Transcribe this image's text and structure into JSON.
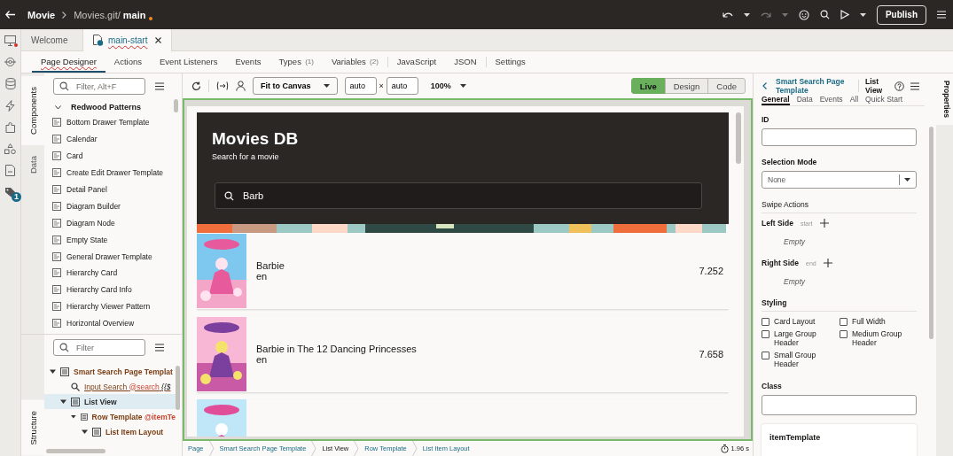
{
  "top_bar": {
    "app": "Movie",
    "path": "Movies.git/",
    "branch": "main",
    "unsaved": true,
    "redo_disabled": true,
    "publish": "Publish"
  },
  "rail": {
    "alert": true,
    "badge": "1"
  },
  "editor_tabs": [
    {
      "label": "Welcome",
      "selected": false
    },
    {
      "label": "main-start",
      "selected": true
    }
  ],
  "designer_tabs": [
    {
      "label": "Page Designer",
      "selected": true
    },
    {
      "label": "Actions",
      "selected": false
    },
    {
      "label": "Event Listeners",
      "selected": false
    },
    {
      "label": "Events",
      "selected": false
    },
    {
      "label": "Types",
      "count": "(1)",
      "selected": false
    },
    {
      "label": "Variables",
      "count": "(2)",
      "selected": false
    },
    {
      "label": "JavaScript",
      "selected": false,
      "separator_before": true
    },
    {
      "label": "JSON",
      "selected": false
    },
    {
      "label": "Settings",
      "selected": false,
      "separator_before": true
    }
  ],
  "side_tabs": [
    {
      "label": "Components",
      "selected": true
    },
    {
      "label": "Data",
      "selected": false
    }
  ],
  "components": {
    "placeholder": "Filter, Alt+F",
    "group": "Redwood Patterns",
    "expanded": true,
    "items": [
      "Bottom Drawer Template",
      "Calendar",
      "Card",
      "Create Edit Drawer Template",
      "Detail Panel",
      "Diagram Builder",
      "Diagram Node",
      "Empty State",
      "General Drawer Template",
      "Hierarchy Card",
      "Hierarchy Card Info",
      "Hierarchy Viewer Pattern",
      "Horizontal Overview"
    ]
  },
  "structure": {
    "tab": "Structure",
    "placeholder": "Filter",
    "tree": [
      {
        "label": "Smart Search Page Templat",
        "expanded": true,
        "selected": false,
        "children": [
          {
            "kind": "search",
            "label": "Input Search",
            "binding": "@search",
            "extra": "{{$",
            "selected": false
          },
          {
            "label": "List View",
            "expanded": true,
            "selected": true,
            "children": [
              {
                "label": "Row Template",
                "binding": "@itemTe",
                "expanded": true,
                "selected": false,
                "children": [
                  {
                    "label": "List Item Layout",
                    "expanded": true,
                    "selected": false
                  }
                ]
              }
            ]
          }
        ]
      }
    ]
  },
  "toolbar": {
    "fit": "Fit to Canvas",
    "width": "auto",
    "times": "×",
    "height": "auto",
    "zoom": "100%",
    "modes": [
      {
        "label": "Live",
        "selected": true
      },
      {
        "label": "Design",
        "selected": false
      },
      {
        "label": "Code",
        "selected": false
      }
    ]
  },
  "preview": {
    "title": "Movies DB",
    "subtitle": "Search for a movie",
    "search": "Barb",
    "movies": [
      {
        "kind": "movie",
        "title": "Barbie",
        "language": "en",
        "rating": "7.252"
      },
      {
        "kind": "movie",
        "title": "Barbie in The 12 Dancing Princesses",
        "language": "en",
        "rating": "7.658"
      },
      {
        "kind": "partial"
      }
    ]
  },
  "breadcrumb": [
    {
      "label": "Page",
      "current": false
    },
    {
      "label": "Smart Search Page Template",
      "current": false
    },
    {
      "label": "List View",
      "current": true
    },
    {
      "label": "Row Template",
      "current": false
    },
    {
      "label": "List Item Layout",
      "current": false
    }
  ],
  "timing": "1.96 s",
  "properties": {
    "parent": "Smart Search Page Template",
    "component": "List View",
    "tabs": [
      {
        "label": "General",
        "selected": true
      },
      {
        "label": "Data",
        "selected": false
      },
      {
        "label": "Events",
        "selected": false
      },
      {
        "label": "All",
        "selected": false
      },
      {
        "label": "Quick Start",
        "selected": false
      }
    ],
    "id_label": "ID",
    "selection_label": "Selection Mode",
    "selection_value": "None",
    "swipe_title": "Swipe Actions",
    "swipe": [
      {
        "label": "Left Side",
        "slot": "start",
        "empty": "Empty"
      },
      {
        "label": "Right Side",
        "slot": "end",
        "empty": "Empty"
      }
    ],
    "styling_title": "Styling",
    "styling": [
      {
        "label": "Card Layout",
        "checked": false
      },
      {
        "label": "Full Width",
        "checked": false
      },
      {
        "label": "Large Group Header",
        "checked": false
      },
      {
        "label": "Medium Group Header",
        "checked": false
      },
      {
        "label": "Small Group Header",
        "checked": false
      }
    ],
    "class_label": "Class",
    "template_card": "itemTemplate"
  },
  "properties_tab": "Properties"
}
